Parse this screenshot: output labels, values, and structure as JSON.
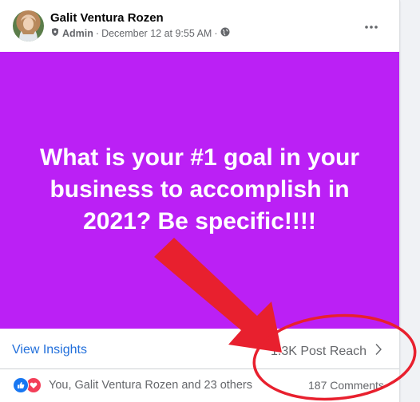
{
  "post": {
    "author": "Galit Ventura Rozen",
    "role": "Admin",
    "separator": "·",
    "timestamp": "December 12 at 9:55 AM",
    "separator2": "·",
    "privacy_icon": "globe-icon",
    "menu_icon": "more-options-icon"
  },
  "image": {
    "background": "#bb20f5",
    "lines": [
      "What is your #1 goal in your",
      "business to accomplish in",
      "2021? Be specific!!!!"
    ]
  },
  "insights": {
    "view_label": "View Insights",
    "reach_label": "1.3K Post Reach",
    "chevron_icon": "chevron-right-icon"
  },
  "footer": {
    "reactions_text": "You, Galit Ventura Rozen and 23 others",
    "comments": "187 Comments"
  },
  "colors": {
    "link_blue": "#216fdb",
    "arrow_red": "#e8202e",
    "like_blue": "#1877f2",
    "love_red": "#f33e58"
  }
}
